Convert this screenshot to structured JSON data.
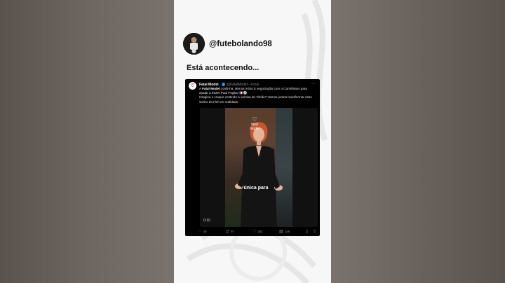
{
  "post": {
    "handle": "@futebolando98",
    "caption": "Está acontecendo..."
  },
  "tweet": {
    "logo_icon": "fatal-model-logo",
    "author_name": "Fatal Model",
    "meta": "@FatalModel · 4 min",
    "more": "···",
    "text_prefix": "A ",
    "text_brand": "Fatal Model",
    "text_body": " confirma: demos início à negociação com o Corinthians para ajudar a trazer Paul Pogba! 🇫🇷⚽",
    "text_line2": "Imagina o craque vestindo a camisa do Timão? Vamos juntos transformar esse sonho da Fiel em realidade.",
    "video": {
      "logo_text": "fatal model",
      "subtitle": "única para",
      "time": "0:10"
    },
    "actions": {
      "replies": "48",
      "retweets": "97",
      "likes": "261",
      "views": "14K"
    }
  },
  "colors": {
    "verified": "#1d9bf0",
    "card_bg": "#f7f7f7",
    "tweet_bg": "#000000"
  }
}
